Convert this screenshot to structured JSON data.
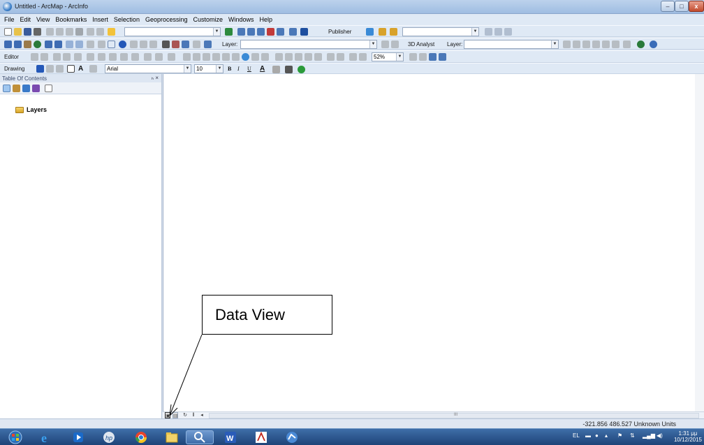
{
  "window": {
    "title": "Untitled - ArcMap - ArcInfo",
    "min_glyph": "–",
    "max_glyph": "□",
    "close_glyph": "x"
  },
  "menu": [
    "File",
    "Edit",
    "View",
    "Bookmarks",
    "Insert",
    "Selection",
    "Geoprocessing",
    "Customize",
    "Windows",
    "Help"
  ],
  "toolbars": {
    "publisher_label": "Publisher",
    "layer_label": "Layer:",
    "analyst_label": "3D Analyst",
    "layer2_label": "Layer:",
    "editor_label": "Editor",
    "zoom_value": "52%",
    "drawing_label": "Drawing",
    "font_name": "Arial",
    "font_size": "10",
    "bold": "B",
    "italic": "I",
    "underline": "U",
    "font_color": "A"
  },
  "toc": {
    "title": "Table Of Contents",
    "pin": "ₕ ×",
    "layers_label": "Layers"
  },
  "status": {
    "coordinates": "-321.856  486.527 Unknown Units",
    "scroll_mark": "III"
  },
  "annotation": {
    "callout_text": "Data View"
  },
  "taskbar": {
    "apps": [
      "start-orb-icon",
      "internet-explorer-icon",
      "media-player-icon",
      "hp-icon",
      "chrome-icon",
      "file-explorer-icon",
      "search-icon",
      "word-icon",
      "acrobat-icon",
      "arcmap-icon"
    ],
    "lang": "EL",
    "time": "1:31 μμ",
    "date": "10/12/2015"
  }
}
